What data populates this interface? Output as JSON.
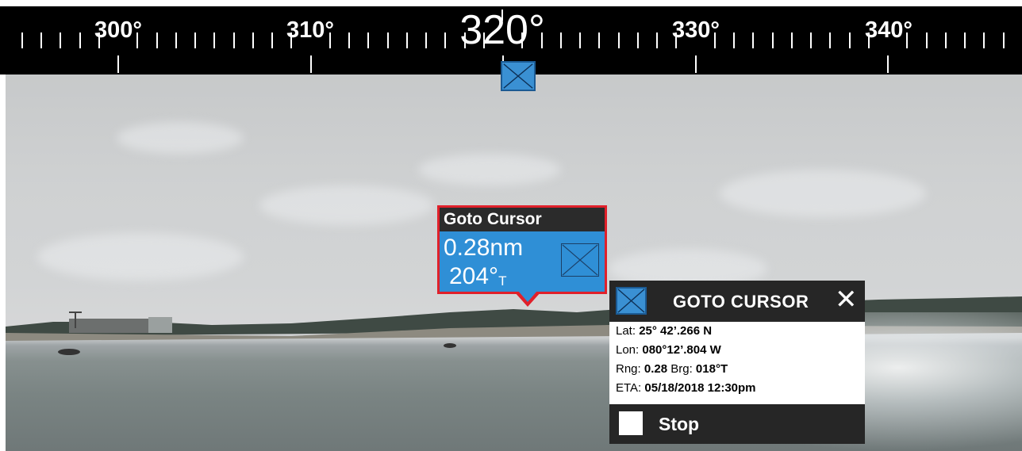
{
  "compass": {
    "headings": [
      {
        "label": "300°",
        "size": "small"
      },
      {
        "label": "310°",
        "size": "small"
      },
      {
        "label": "320°",
        "size": "big"
      },
      {
        "label": "330°",
        "size": "small"
      },
      {
        "label": "340°",
        "size": "small"
      }
    ],
    "current_heading": "320°",
    "waypoint_icon": "waypoint-x-icon"
  },
  "goto_label": {
    "title": "Goto Cursor",
    "range": "0.28nm",
    "bearing": "204°",
    "bearing_ref": "T",
    "icon": "waypoint-x-icon"
  },
  "panel": {
    "title": "GOTO CURSOR",
    "close_glyph": "✕",
    "rows": [
      {
        "label": "Lat: ",
        "value": "25° 42’.266 N"
      },
      {
        "label": "Lon: ",
        "value": "080°12’.804 W"
      },
      {
        "label": "Rng: ",
        "value": "0.28",
        "label2": " Brg: ",
        "value2": "018°T"
      },
      {
        "label": "ETA: ",
        "value": "05/18/2018 12:30pm"
      }
    ],
    "stop_label": "Stop"
  },
  "colors": {
    "accent_blue": "#3a90d3",
    "highlight_red": "#e0202a",
    "panel_dark": "#262626",
    "compass_bg": "#000000"
  }
}
